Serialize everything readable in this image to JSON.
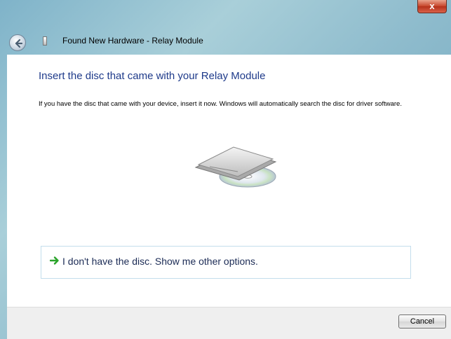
{
  "window": {
    "title": "Found New Hardware - Relay Module",
    "close_label": "x"
  },
  "main": {
    "heading": "Insert the disc that came with your Relay Module",
    "description": "If you have the disc that came with your device, insert it now.  Windows will automatically search the disc for driver software.",
    "option_label": "I don't have the disc.  Show me other options."
  },
  "footer": {
    "cancel_label": "Cancel"
  },
  "colors": {
    "heading": "#1e3a8a",
    "arrow": "#2aa32a",
    "close": "#c7452a"
  }
}
